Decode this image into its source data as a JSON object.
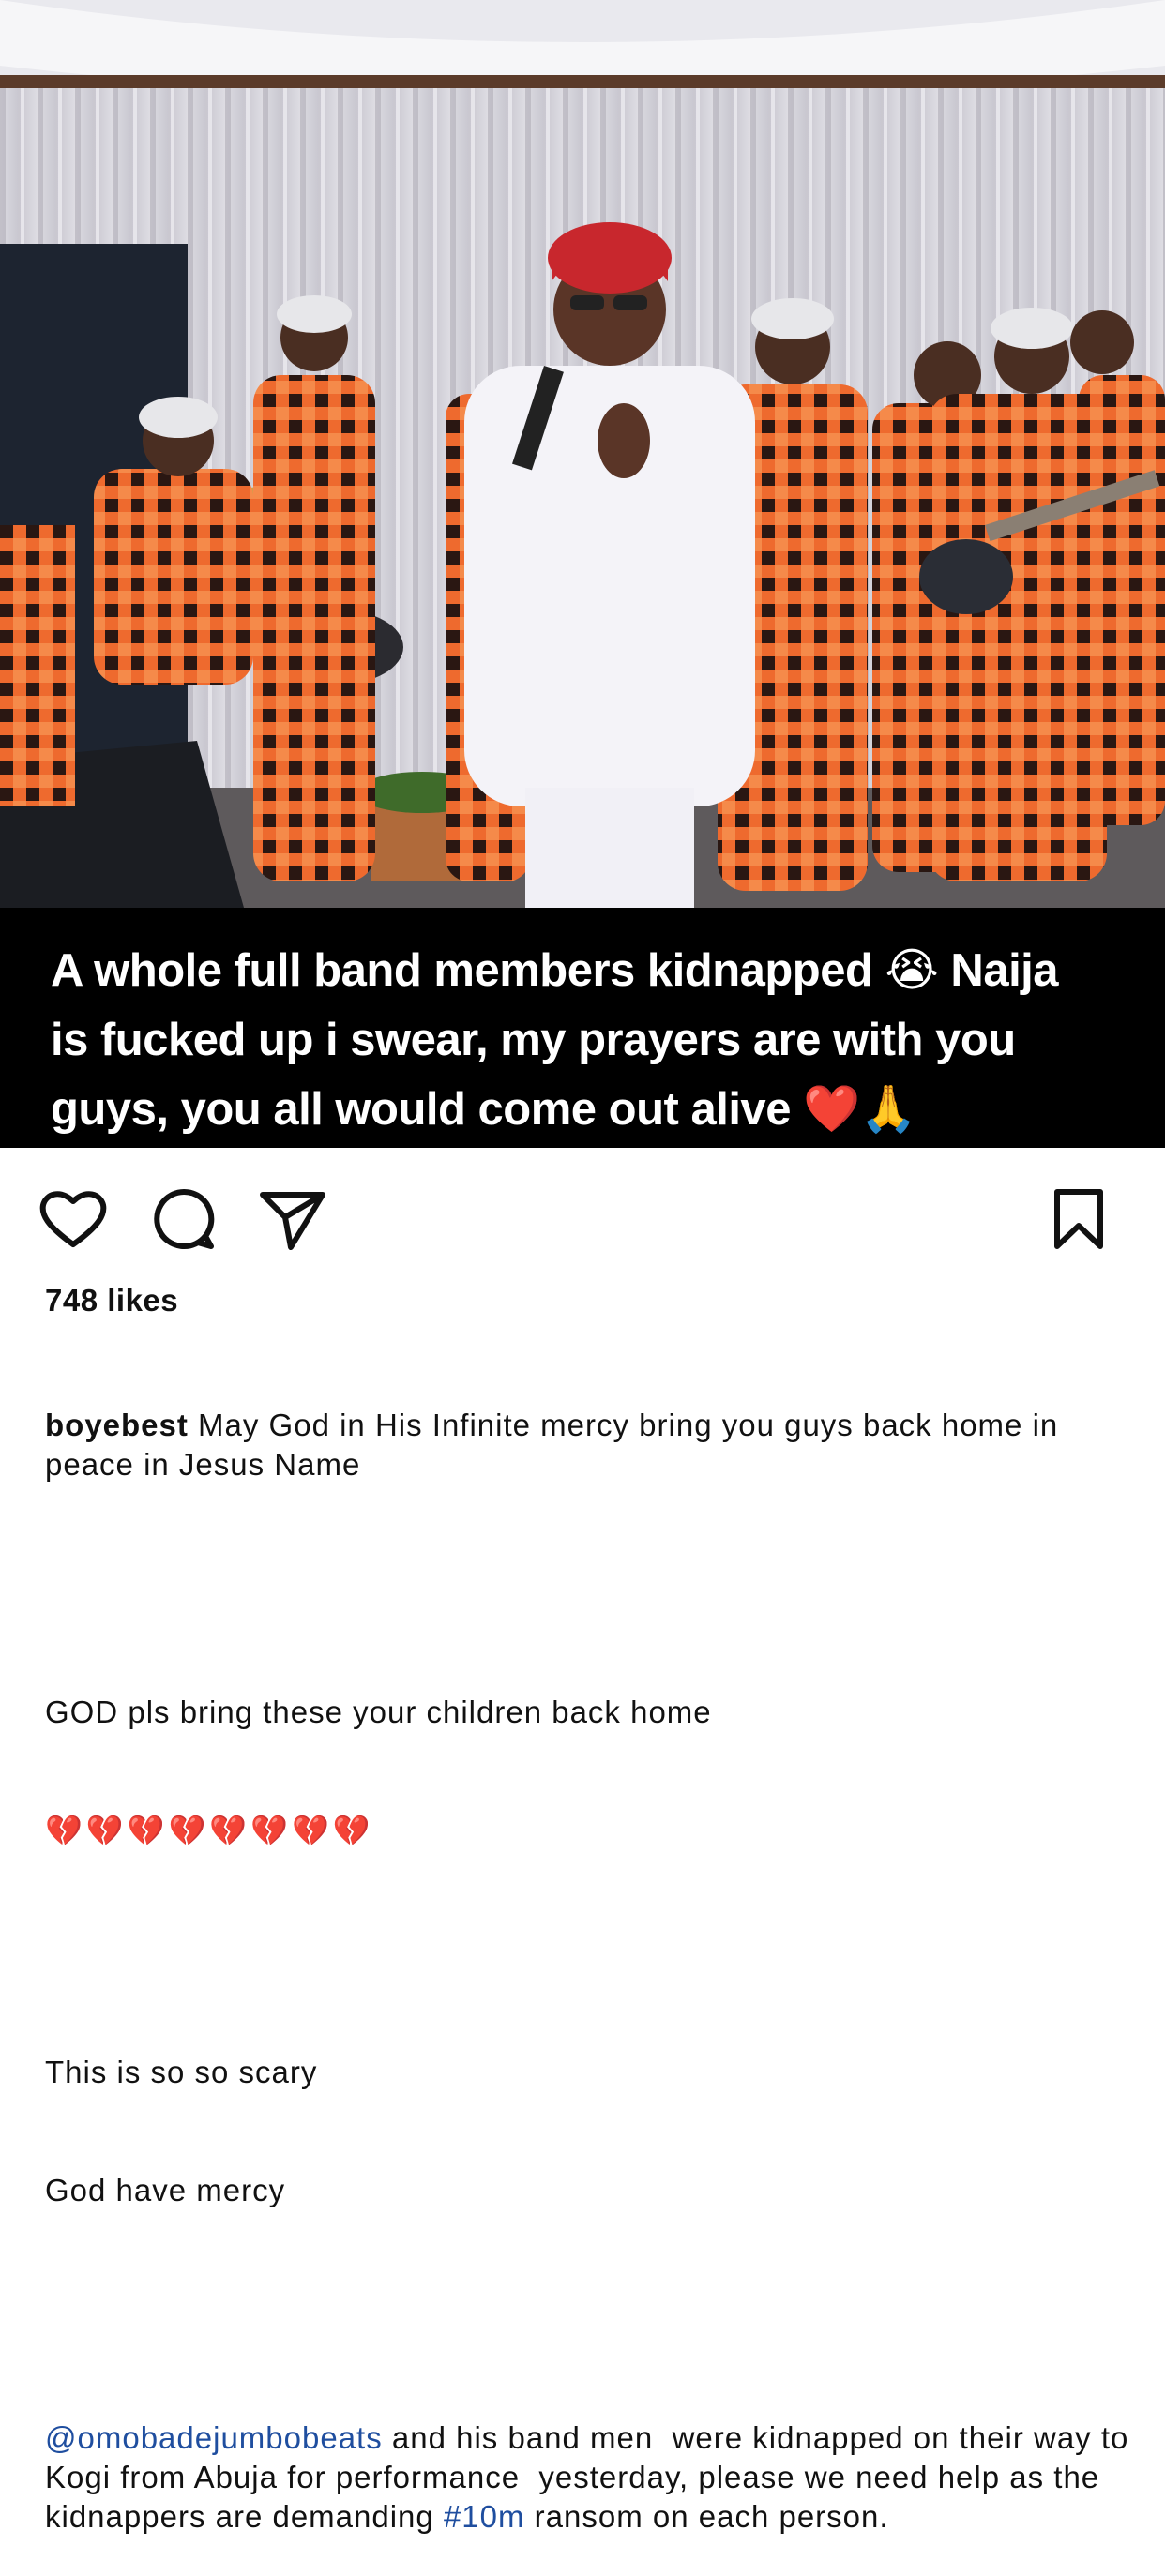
{
  "caption": {
    "line1": "A whole full band members kidnapped",
    "line1_emoji": "😭",
    "line1_end": " Naija",
    "line2": "is fucked up i swear, my prayers are with you",
    "line3": "guys, you all would come out alive ",
    "line3_emoji": "❤️🙏"
  },
  "actions": {
    "like_icon": "heart-outline-icon",
    "comment_icon": "comment-bubble-icon",
    "share_icon": "paper-plane-icon",
    "save_icon": "bookmark-icon"
  },
  "likes": "748 likes",
  "post": {
    "username": "boyebest",
    "paragraph1": " May God in His Infinite mercy bring you guys back home in peace in Jesus Name",
    "paragraph2": "GOD pls bring these your children back home",
    "hearts": "💔💔💔💔💔💔💔💔",
    "paragraph3_line1": "This is so so scary",
    "paragraph3_line2": "God have mercy",
    "mention": "@omobadejumbobeats",
    "paragraph4_a": " and his band men  were kidnapped on their way to Kogi from Abuja for performance  yesterday, please we need help as the kidnappers are demanding ",
    "hashtag": "#10m",
    "paragraph4_b": " ransom on each person."
  },
  "colors": {
    "link": "#1f4e9f",
    "caption_band": "#000000",
    "outfit_orange": "#e8612a"
  }
}
